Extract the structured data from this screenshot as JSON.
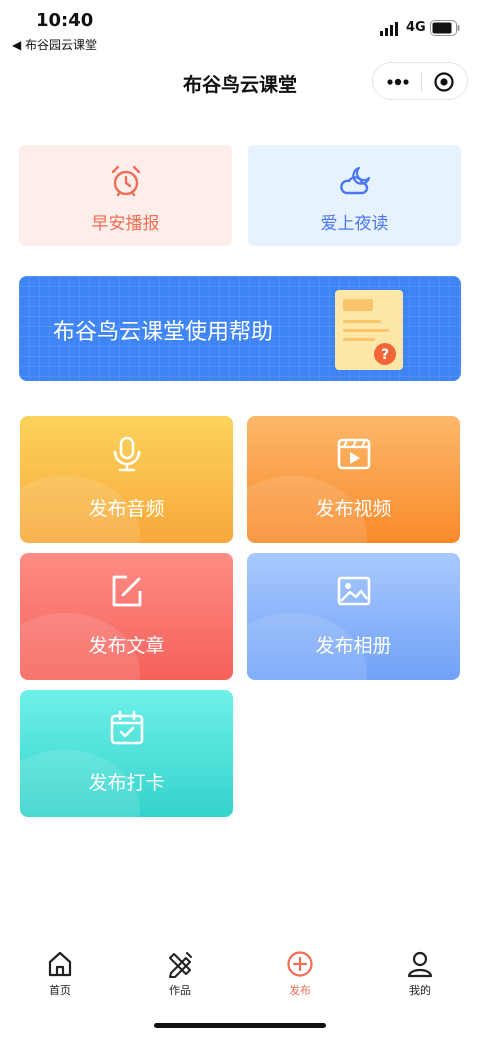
{
  "status_bar": {
    "time": "10:40",
    "back_label": "◀ 布谷园云课堂",
    "network": "4G"
  },
  "nav": {
    "title": "布谷鸟云课堂"
  },
  "quick_cards": [
    {
      "label": "早安播报",
      "icon": "alarm-clock-icon",
      "color": "#ef6e54"
    },
    {
      "label": "爱上夜读",
      "icon": "moon-cloud-icon",
      "color": "#4d77f2"
    }
  ],
  "banner": {
    "text": "布谷鸟云课堂使用帮助",
    "icon": "help-document-icon"
  },
  "publish_tiles": [
    {
      "label": "发布音频",
      "icon": "microphone-icon"
    },
    {
      "label": "发布视频",
      "icon": "video-icon"
    },
    {
      "label": "发布文章",
      "icon": "edit-icon"
    },
    {
      "label": "发布相册",
      "icon": "image-icon"
    },
    {
      "label": "发布打卡",
      "icon": "calendar-check-icon"
    }
  ],
  "tabbar": {
    "items": [
      {
        "label": "首页",
        "icon": "home-icon"
      },
      {
        "label": "作品",
        "icon": "pencil-ruler-icon"
      },
      {
        "label": "发布",
        "icon": "plus-circle-icon",
        "active": true
      },
      {
        "label": "我的",
        "icon": "user-icon"
      }
    ],
    "active_color": "#ef6e54"
  }
}
